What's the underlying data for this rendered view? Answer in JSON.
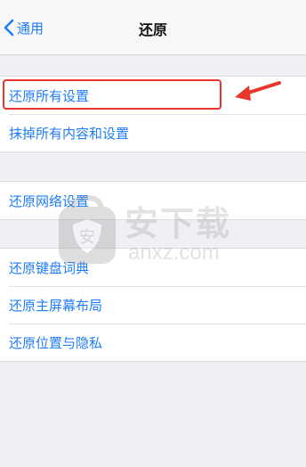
{
  "nav": {
    "back_label": "通用",
    "title": "还原"
  },
  "groups": [
    {
      "items": [
        "还原所有设置",
        "抹掉所有内容和设置"
      ]
    },
    {
      "items": [
        "还原网络设置"
      ]
    },
    {
      "items": [
        "还原键盘词典",
        "还原主屏幕布局",
        "还原位置与隐私"
      ]
    }
  ],
  "watermark": {
    "cn": "安下载",
    "en": "anxz.com"
  },
  "colors": {
    "accent": "#1f7df4",
    "background": "#efeff4",
    "highlight": "#e8362a"
  },
  "icons": {
    "back": "chevron-left-icon",
    "annotation": "red-arrow-icon",
    "watermark": "shield-icon"
  }
}
